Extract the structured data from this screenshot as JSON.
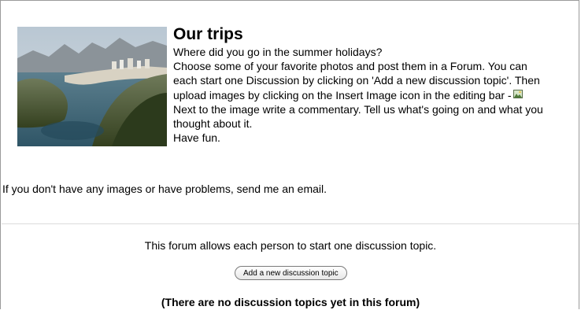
{
  "intro": {
    "title": "Our trips",
    "lines": [
      "Where did you go in the summer holidays?",
      "Choose some of your favorite photos and post them in a Forum. You can",
      "each start one Discussion by clicking on 'Add a new discussion topic'. Then",
      "upload images by clicking on the Insert Image icon in the editing bar -",
      "Next to the image write a commentary. Tell us what's going on and what you",
      "thought about it.",
      "Have fun."
    ],
    "footer_line": "If you don't have any images or have problems, send me an email.",
    "icons": {
      "photo": "landscape-photo",
      "insert_image": "insert-image-icon"
    }
  },
  "forum": {
    "info": "This forum allows each person to start one discussion topic.",
    "add_button_label": "Add a new discussion topic",
    "empty_message": "(There are no discussion topics yet in this forum)"
  }
}
